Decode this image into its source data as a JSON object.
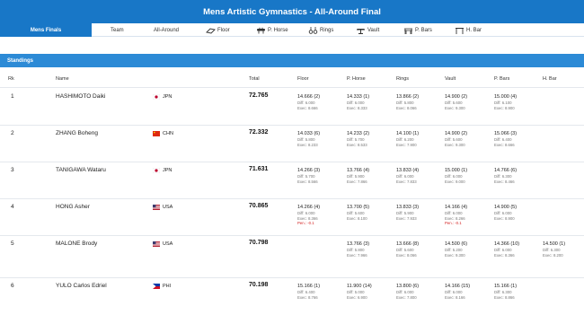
{
  "title": "Mens Artistic Gymnastics - All-Around Final",
  "tabs": [
    {
      "label": "Mens Finals",
      "icon": "",
      "active": true
    },
    {
      "label": "Team",
      "icon": ""
    },
    {
      "label": "All-Around",
      "icon": ""
    },
    {
      "label": "Floor",
      "icon": "floor-icon"
    },
    {
      "label": "P. Horse",
      "icon": "pommel-horse-icon"
    },
    {
      "label": "Rings",
      "icon": "rings-icon"
    },
    {
      "label": "Vault",
      "icon": "vault-icon"
    },
    {
      "label": "P. Bars",
      "icon": "parallel-bars-icon"
    },
    {
      "label": "H. Bar",
      "icon": "horizontal-bar-icon"
    }
  ],
  "section_title": "Standings",
  "columns": [
    "Rk",
    "Name",
    "Total",
    "Floor",
    "P. Horse",
    "Rings",
    "Vault",
    "P. Bars",
    "H. Bar"
  ],
  "colors": {
    "header": "#1877c7",
    "standings": "#2c8ad6",
    "penalty": "#d32020"
  },
  "rows": [
    {
      "rank": "1",
      "name": "HASHIMOTO Daiki",
      "country": "JPN",
      "flag": "japan-flag",
      "total": "72.765",
      "events": [
        {
          "score": "14.666 (2)",
          "diff": "Diff: 6.000",
          "exec": "Exec: 8.666"
        },
        {
          "score": "14.333 (1)",
          "diff": "Diff: 6.000",
          "exec": "Exec: 8.333"
        },
        {
          "score": "13.866 (2)",
          "diff": "Diff: 5.800",
          "exec": "Exec: 8.066"
        },
        {
          "score": "14.900 (2)",
          "diff": "Diff: 5.600",
          "exec": "Exec: 9.300"
        },
        {
          "score": "15.000 (4)",
          "diff": "Diff: 6.100",
          "exec": "Exec: 8.900"
        },
        null
      ]
    },
    {
      "rank": "2",
      "name": "ZHANG Boheng",
      "country": "CHN",
      "flag": "china-flag",
      "total": "72.332",
      "events": [
        {
          "score": "14.033 (6)",
          "diff": "Diff: 5.800",
          "exec": "Exec: 8.233"
        },
        {
          "score": "14.233 (2)",
          "diff": "Diff: 5.700",
          "exec": "Exec: 8.533"
        },
        {
          "score": "14.100 (1)",
          "diff": "Diff: 6.200",
          "exec": "Exec: 7.900"
        },
        {
          "score": "14.900 (2)",
          "diff": "Diff: 5.600",
          "exec": "Exec: 9.300"
        },
        {
          "score": "15.066 (3)",
          "diff": "Diff: 6.400",
          "exec": "Exec: 8.666"
        },
        null
      ]
    },
    {
      "rank": "3",
      "name": "TANIGAWA Wataru",
      "country": "JPN",
      "flag": "japan-flag",
      "total": "71.631",
      "events": [
        {
          "score": "14.266 (3)",
          "diff": "Diff: 5.700",
          "exec": "Exec: 8.566"
        },
        {
          "score": "13.766 (4)",
          "diff": "Diff: 5.900",
          "exec": "Exec: 7.866"
        },
        {
          "score": "13.833 (4)",
          "diff": "Diff: 6.000",
          "exec": "Exec: 7.833"
        },
        {
          "score": "15.000 (1)",
          "diff": "Diff: 6.000",
          "exec": "Exec: 9.000"
        },
        {
          "score": "14.766 (6)",
          "diff": "Diff: 6.300",
          "exec": "Exec: 8.466"
        },
        null
      ]
    },
    {
      "rank": "4",
      "name": "HONG Asher",
      "country": "USA",
      "flag": "usa-flag",
      "total": "70.865",
      "events": [
        {
          "score": "14.266 (4)",
          "diff": "Diff: 6.000",
          "exec": "Exec: 8.366",
          "pen": "Pen.: -0.1"
        },
        {
          "score": "13.700 (5)",
          "diff": "Diff: 5.600",
          "exec": "Exec: 8.100"
        },
        {
          "score": "13.833 (3)",
          "diff": "Diff: 5.900",
          "exec": "Exec: 7.933"
        },
        {
          "score": "14.166 (4)",
          "diff": "Diff: 6.000",
          "exec": "Exec: 8.266",
          "pen": "Pen.: -0.1"
        },
        {
          "score": "14.900 (5)",
          "diff": "Diff: 6.000",
          "exec": "Exec: 8.900"
        },
        null
      ]
    },
    {
      "rank": "5",
      "name": "MALONE Brody",
      "country": "USA",
      "flag": "usa-flag",
      "total": "70.798",
      "events": [
        null,
        {
          "score": "13.766 (3)",
          "diff": "Diff: 5.800",
          "exec": "Exec: 7.966"
        },
        {
          "score": "13.666 (8)",
          "diff": "Diff: 5.600",
          "exec": "Exec: 8.066"
        },
        {
          "score": "14.500 (6)",
          "diff": "Diff: 5.200",
          "exec": "Exec: 9.300"
        },
        {
          "score": "14.366 (10)",
          "diff": "Diff: 6.000",
          "exec": "Exec: 8.366"
        },
        {
          "score": "14.500 (1)",
          "diff": "Diff: 6.300",
          "exec": "Exec: 8.200"
        }
      ]
    },
    {
      "rank": "6",
      "name": "YULO Carlos Edriel",
      "country": "PHI",
      "flag": "philippines-flag",
      "total": "70.198",
      "events": [
        {
          "score": "15.166 (1)",
          "diff": "Diff: 6.400",
          "exec": "Exec: 8.766"
        },
        {
          "score": "11.900 (14)",
          "diff": "Diff: 5.000",
          "exec": "Exec: 6.900"
        },
        {
          "score": "13.800 (6)",
          "diff": "Diff: 6.000",
          "exec": "Exec: 7.800"
        },
        {
          "score": "14.166 (15)",
          "diff": "Diff: 6.000",
          "exec": "Exec: 8.166"
        },
        {
          "score": "15.166 (1)",
          "diff": "Diff: 6.300",
          "exec": "Exec: 8.866"
        },
        null
      ]
    }
  ]
}
